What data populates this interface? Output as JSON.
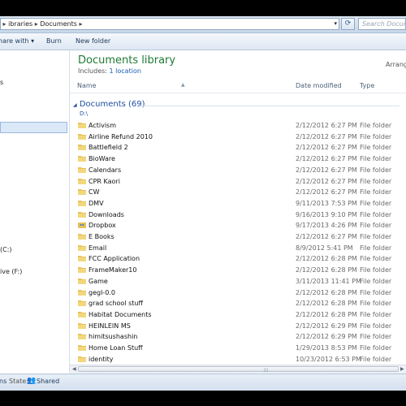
{
  "address": {
    "crumbs": [
      "ibraries",
      "Documents"
    ],
    "search_placeholder": "Search Docume"
  },
  "toolbar": {
    "share_label": "hare with",
    "burn_label": "Burn",
    "new_folder_label": "New folder"
  },
  "sidebar": {
    "item1": "s",
    "item2": "(C:)",
    "item3": "ive (F:)"
  },
  "library": {
    "title": "Documents library",
    "includes_label": "Includes:",
    "includes_link": "1 location",
    "arrange": "Arrang"
  },
  "columns": {
    "name": "Name",
    "date": "Date modified",
    "type": "Type"
  },
  "group": {
    "label": "Documents (69)",
    "path": "D:\\"
  },
  "rows": [
    {
      "name": "Activism",
      "date": "2/12/2012 6:27 PM",
      "type": "File folder",
      "icon": "folder-icon"
    },
    {
      "name": "Airline Refund 2010",
      "date": "2/12/2012 6:27 PM",
      "type": "File folder",
      "icon": "folder-icon"
    },
    {
      "name": "Battlefield 2",
      "date": "2/12/2012 6:27 PM",
      "type": "File folder",
      "icon": "folder-icon"
    },
    {
      "name": "BioWare",
      "date": "2/12/2012 6:27 PM",
      "type": "File folder",
      "icon": "folder-icon"
    },
    {
      "name": "Calendars",
      "date": "2/12/2012 6:27 PM",
      "type": "File folder",
      "icon": "folder-icon"
    },
    {
      "name": "CPR Kaori",
      "date": "2/12/2012 6:27 PM",
      "type": "File folder",
      "icon": "folder-icon"
    },
    {
      "name": "CW",
      "date": "2/12/2012 6:27 PM",
      "type": "File folder",
      "icon": "folder-icon"
    },
    {
      "name": "DMV",
      "date": "9/11/2013 7:53 PM",
      "type": "File folder",
      "icon": "folder-icon"
    },
    {
      "name": "Downloads",
      "date": "9/16/2013 9:10 PM",
      "type": "File folder",
      "icon": "folder-icon"
    },
    {
      "name": "Dropbox",
      "date": "9/17/2013 4:26 PM",
      "type": "File folder",
      "icon": "dropbox-folder-icon"
    },
    {
      "name": "E Books",
      "date": "2/12/2012 6:27 PM",
      "type": "File folder",
      "icon": "folder-icon"
    },
    {
      "name": "Email",
      "date": "8/9/2012 5:41 PM",
      "type": "File folder",
      "icon": "folder-icon"
    },
    {
      "name": "FCC Application",
      "date": "2/12/2012 6:28 PM",
      "type": "File folder",
      "icon": "folder-icon"
    },
    {
      "name": "FrameMaker10",
      "date": "2/12/2012 6:28 PM",
      "type": "File folder",
      "icon": "folder-icon"
    },
    {
      "name": "Game",
      "date": "3/11/2013 11:41 PM",
      "type": "File folder",
      "icon": "folder-icon"
    },
    {
      "name": "gegl-0.0",
      "date": "2/12/2012 6:28 PM",
      "type": "File folder",
      "icon": "folder-icon"
    },
    {
      "name": "grad school stuff",
      "date": "2/12/2012 6:28 PM",
      "type": "File folder",
      "icon": "folder-icon"
    },
    {
      "name": "Habitat Documents",
      "date": "2/12/2012 6:28 PM",
      "type": "File folder",
      "icon": "folder-icon"
    },
    {
      "name": "HEINLEIN MS",
      "date": "2/12/2012 6:29 PM",
      "type": "File folder",
      "icon": "folder-icon"
    },
    {
      "name": "himitsushashin",
      "date": "2/12/2012 6:29 PM",
      "type": "File folder",
      "icon": "folder-icon"
    },
    {
      "name": "Home Loan Stuff",
      "date": "1/29/2013 8:53 PM",
      "type": "File folder",
      "icon": "folder-icon"
    },
    {
      "name": "identity",
      "date": "10/23/2012 6:53 PM",
      "type": "File folder",
      "icon": "folder-icon"
    }
  ],
  "status": {
    "prefix": "ns",
    "state_label": "State:",
    "state_value": "Shared"
  },
  "colors": {
    "library_title": "#1f7a34",
    "group_label": "#1e4fa0",
    "link": "#1a5fb4",
    "folder": "#e8c25a"
  }
}
